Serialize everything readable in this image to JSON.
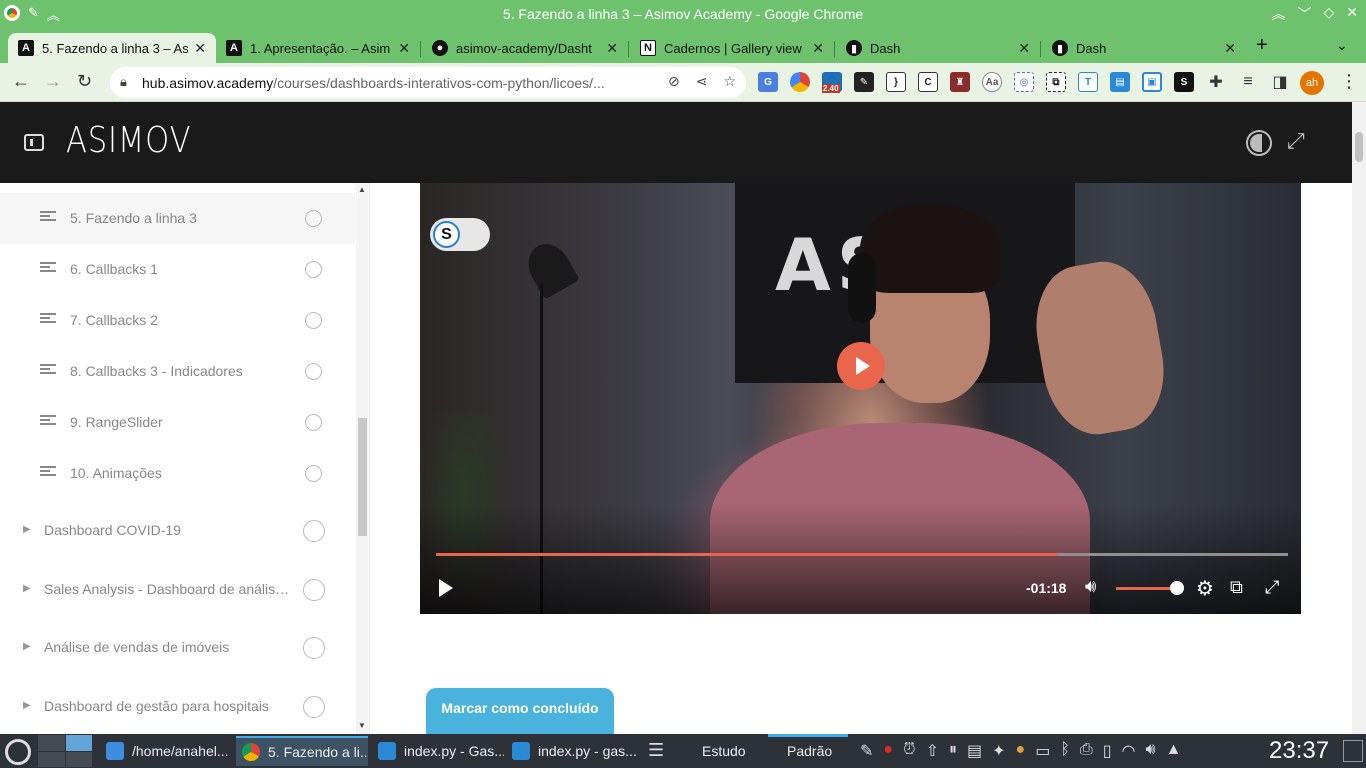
{
  "window": {
    "title": "5. Fazendo a linha 3 – Asimov Academy - Google Chrome"
  },
  "tabs": [
    {
      "label": "5. Fazendo a linha 3 – As",
      "active": true,
      "favicon": "asimov-logo-icon"
    },
    {
      "label": "1. Apresentação. – Asim",
      "active": false,
      "favicon": "asimov-logo-icon"
    },
    {
      "label": "asimov-academy/Dasht",
      "active": false,
      "favicon": "github-icon"
    },
    {
      "label": "Cadernos | Gallery view",
      "active": false,
      "favicon": "notion-icon"
    },
    {
      "label": "Dash",
      "active": false,
      "favicon": "dash-icon"
    },
    {
      "label": "Dash",
      "active": false,
      "favicon": "dash-icon"
    }
  ],
  "omnibox": {
    "domain": "hub.asimov.academy",
    "path": "/courses/dashboards-interativos-com-python/licoes/..."
  },
  "extensions": {
    "badge": "2.40"
  },
  "profile": {
    "initials": "ah"
  },
  "app": {
    "brand": "ASIMOV"
  },
  "sidebar": {
    "lessons": [
      {
        "label": "5. Fazendo a linha 3",
        "active": true
      },
      {
        "label": "6. Callbacks 1",
        "active": false
      },
      {
        "label": "7. Callbacks 2",
        "active": false
      },
      {
        "label": "8. Callbacks 3 - Indicadores",
        "active": false
      },
      {
        "label": "9. RangeSlider",
        "active": false
      },
      {
        "label": "10. Animações",
        "active": false
      }
    ],
    "modules": [
      {
        "label": "Dashboard COVID-19"
      },
      {
        "label": "Sales Analysis - Dashboard de análise de ..."
      },
      {
        "label": "Análise de vendas de imóveis"
      },
      {
        "label": "Dashboard de gestão para hospitais"
      }
    ]
  },
  "video": {
    "wall_text": "ASI",
    "toggle_letter": "S",
    "time_remaining": "-01:18",
    "progress_fraction": 0.73,
    "volume_fraction": 1.0,
    "accent_color": "#e9664c"
  },
  "actions": {
    "mark_complete": "Marcar como concluído"
  },
  "taskbar": {
    "tasks": [
      {
        "label": "/home/anahel...",
        "active": false,
        "icon": "folder-icon"
      },
      {
        "label": "5. Fazendo a li...",
        "active": true,
        "icon": "chrome-icon"
      },
      {
        "label": "index.py - Gas...",
        "active": false,
        "icon": "vscode-icon"
      },
      {
        "label": "index.py - gas...",
        "active": false,
        "icon": "vscode-icon"
      }
    ],
    "activities": [
      "Estudo",
      "Padrão"
    ],
    "active_activity": "Padrão",
    "clock": "23:37"
  }
}
